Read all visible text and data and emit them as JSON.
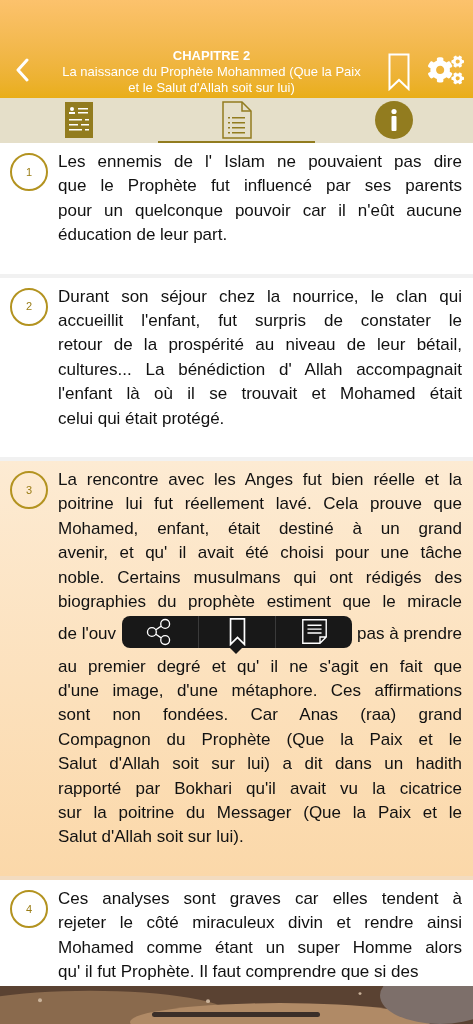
{
  "header": {
    "chapter": "CHAPITRE 2",
    "title": "La naissance du Prophète Mohammed (Que la Paix et le Salut d'Allah soit sur lui)"
  },
  "tabs": [
    {
      "kind": "summary",
      "selected": false
    },
    {
      "kind": "text",
      "selected": true
    },
    {
      "kind": "info",
      "selected": false
    }
  ],
  "paragraphs": [
    {
      "number": "1",
      "selected": false,
      "lines": [
        [
          "Les ennemis de l' Islam ne pouvaient pas dire"
        ],
        [
          "que le Prophète fut influencé par ses parents"
        ],
        [
          "pour un quelconque pouvoir car il n'eût aucune"
        ],
        [
          "éducation de leur part."
        ]
      ]
    },
    {
      "number": "2",
      "selected": false,
      "lines": [
        [
          "Durant son séjour chez la nourrice, le clan qui"
        ],
        [
          "accueillit l'enfant, fut surpris de constater le"
        ],
        [
          "retour de la prospérité au niveau de leur bétail,"
        ],
        [
          "cultures... La bénédiction d' Allah accompagnait"
        ],
        [
          "l'enfant là où il se trouvait et Mohamed était"
        ],
        [
          "celui qui était protégé."
        ]
      ]
    },
    {
      "number": "3",
      "selected": true,
      "lines": [
        [
          "La rencontre avec les Anges fut bien réelle et la"
        ],
        [
          "poitrine lui fut réellement lavé. Cela prouve que"
        ],
        [
          "Mohamed, enfant, était destiné à un grand"
        ],
        [
          "avenir, et qu' il avait été choisi pour une tâche"
        ],
        [
          "noble. Certains musulmans qui ont rédigés des"
        ],
        [
          "biographies du prophète estiment que le miracle"
        ],
        [
          "de l'ouv",
          "pas à prendre"
        ],
        [
          "au premier degré et qu' il ne s'agit en fait que"
        ],
        [
          "d'une image, d'une métaphore. Ces affirmations"
        ],
        [
          "sont non fondées. Car Anas (raa) grand"
        ],
        [
          "Compagnon du Prophète (Que la Paix et le"
        ],
        [
          "Salut d'Allah soit sur lui) a dit dans un hadith"
        ],
        [
          "rapporté par Bokhari qu'il avait vu la cicatrice"
        ],
        [
          "sur la poitrine du Messager (Que la Paix et le"
        ],
        [
          "Salut d'Allah soit sur lui)."
        ]
      ]
    },
    {
      "number": "4",
      "selected": false,
      "lines": [
        [
          "Ces analyses sont graves car elles tendent à"
        ],
        [
          "rejeter le côté miraculeux divin et rendre ainsi"
        ],
        [
          "Mohamed comme étant un super Homme alors"
        ],
        [
          "qu' il fut Prophète. Il faut comprendre que si des"
        ]
      ]
    }
  ]
}
